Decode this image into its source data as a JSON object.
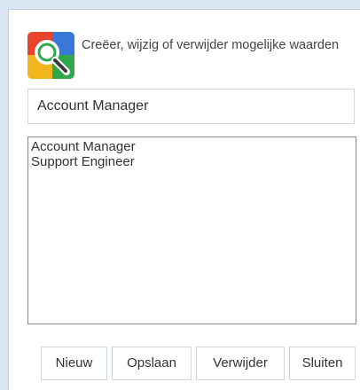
{
  "header": {
    "icon": "search-app-icon",
    "text": "Creëer, wijzig of verwijder mogelijke waarden"
  },
  "input": {
    "value": "Account Manager"
  },
  "list": {
    "items": [
      {
        "label": "Account Manager"
      },
      {
        "label": "Support Engineer"
      }
    ]
  },
  "buttons": {
    "new": "Nieuw",
    "save": "Opslaan",
    "delete": "Verwijder",
    "close": "Sluiten"
  },
  "colors": {
    "background": "#d9e7f4",
    "panel": "#ffffff",
    "border": "#cfd8e2",
    "icon_red": "#e8442e",
    "icon_blue": "#3a78d8",
    "icon_yellow": "#f3b51d",
    "icon_green": "#2ea84a"
  }
}
